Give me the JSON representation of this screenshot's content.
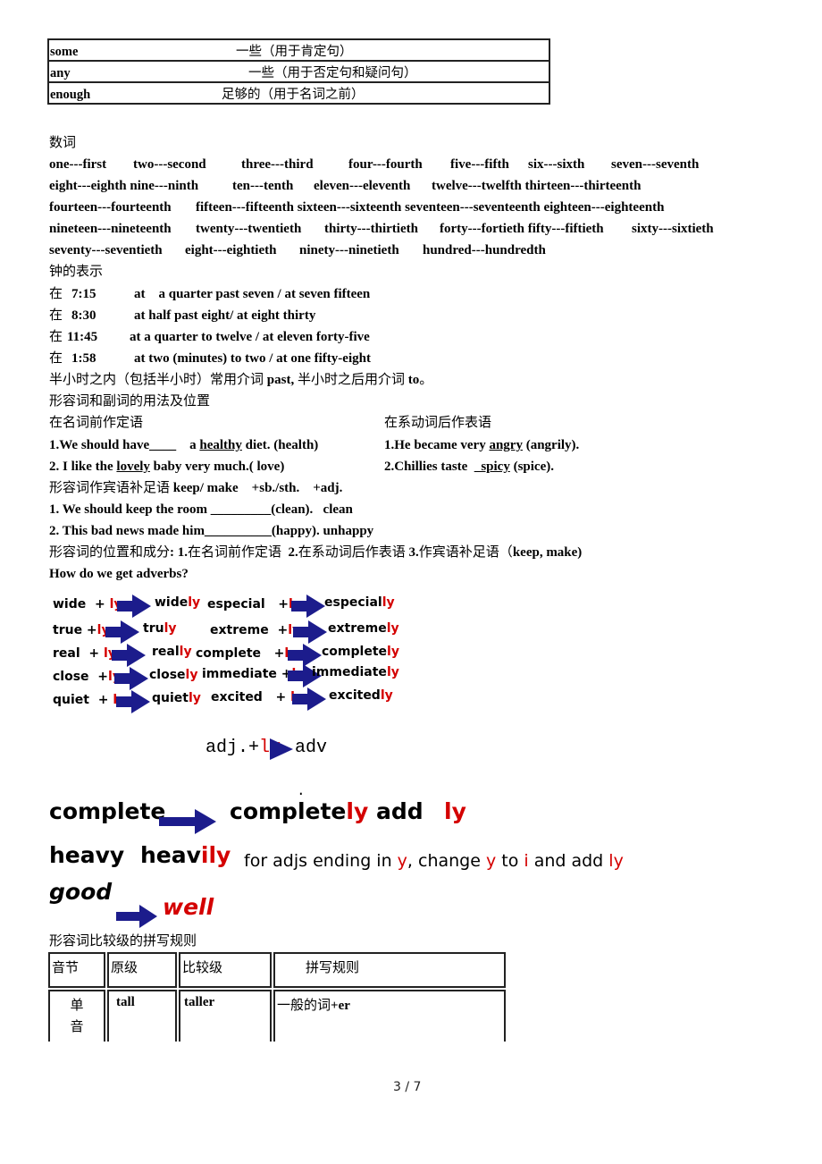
{
  "quantifier_table": [
    {
      "word": "some",
      "meaning": "一些（用于肯定句）"
    },
    {
      "word": "any",
      "meaning": "一些（用于否定句和疑问句）"
    },
    {
      "word": "enough",
      "meaning": "足够的（用于名词之前）"
    }
  ],
  "numerals": {
    "heading": "数词",
    "rows": [
      [
        "one---first",
        "two---second",
        "three---third",
        "four---fourth",
        "five---fifth",
        "six---sixth",
        "seven---seventh"
      ],
      [
        "eight---eighth nine---ninth",
        "ten---tenth",
        "eleven---eleventh",
        "twelve---twelfth thirteen---thirteenth"
      ],
      [
        "fourteen---fourteenth",
        "fifteen---fifteenth sixteen---sixteenth seventeen---seventeenth eighteen---eighteenth"
      ],
      [
        "nineteen---nineteenth",
        "twenty---twentieth",
        "thirty---thirtieth",
        "forty---fortieth fifty---fiftieth",
        "sixty---sixtieth"
      ],
      [
        "seventy---seventieth",
        "eight---eightieth",
        "ninety---ninetieth",
        "hundred---hundredth"
      ]
    ]
  },
  "time": {
    "heading": "钟的表示",
    "prefix": "在",
    "rows": [
      {
        "time": "7:15",
        "expr": "at    a quarter past seven / at seven fifteen"
      },
      {
        "time": "8:30",
        "expr": "at half past eight/ at eight thirty"
      },
      {
        "time": "11:45",
        "expr": "at a quarter to twelve / at eleven forty-five"
      },
      {
        "time": "1:58",
        "expr": "at two (minutes) to two / at one fifty-eight"
      }
    ],
    "note_cn1": "半小时之内（包括半小时）常用介词",
    "note_past": "past,",
    "note_cn2": " 半小时之后用介词",
    "note_to": "to",
    "note_end": "。"
  },
  "adj_adv": {
    "heading": "形容词和副词的用法及位置",
    "left_heading": "在名词前作定语",
    "right_heading": "在系动词后作表语",
    "left_ex1": {
      "pre": "1.We should have____    a ",
      "ans": "healthy",
      "post": " diet. (health)"
    },
    "left_ex2": {
      "pre": "2. I like the ",
      "ans": "lovely",
      "post": " baby very much.( love)"
    },
    "right_ex1": {
      "pre": "1.He became very ",
      "ans": "angry",
      "post": " (angrily)."
    },
    "right_ex2": {
      "pre": "2.Chillies taste  ",
      "ans": "_spicy",
      "post": " (spice)."
    },
    "complement_cn": "形容词作宾语补足语",
    "complement_en": " keep/ make    +sb./sth.    +adj.",
    "comp_ex1": "1. We should keep the room _________(clean).   clean",
    "comp_ex2": "2. This bad news made him__________(happy). unhappy",
    "summary": [
      {
        "t": "形容词的位置和成分",
        "b": false
      },
      {
        "t": ": 1.",
        "b": true
      },
      {
        "t": "在名词前作定语  ",
        "b": false
      },
      {
        "t": "2.",
        "b": true
      },
      {
        "t": "在系动词后作表语 ",
        "b": false
      },
      {
        "t": "3.",
        "b": true
      },
      {
        "t": "作宾语补足语（",
        "b": false
      },
      {
        "t": "keep, make)",
        "b": true
      }
    ],
    "question": "How do we get adverbs?"
  },
  "adverb_examples": [
    {
      "base": "wide  + ",
      "suffix": "ly",
      "result_stem": "wide",
      "result_suffix": "ly"
    },
    {
      "base": "especial   +",
      "suffix": "ly",
      "result_stem": "especial",
      "result_suffix": "ly"
    },
    {
      "base": "true +",
      "suffix": "ly",
      "result_stem": "tru",
      "result_suffix": "ly"
    },
    {
      "base": "extreme  +",
      "suffix": "ly",
      "result_stem": "extreme",
      "result_suffix": "ly"
    },
    {
      "base": "real  + ",
      "suffix": "ly",
      "result_stem": "real",
      "result_suffix": "ly"
    },
    {
      "base": "complete   +",
      "suffix": "ly",
      "result_stem": "complete",
      "result_suffix": "ly"
    },
    {
      "base": "close  +",
      "suffix": "ly",
      "result_stem": "close",
      "result_suffix": "ly"
    },
    {
      "base": "immediate +",
      "suffix": "ly",
      "result_stem": "immediate",
      "result_suffix": "ly"
    },
    {
      "base": "quiet  + ",
      "suffix": "ly",
      "result_stem": "quiet",
      "result_suffix": "ly"
    },
    {
      "base": "excited   + ",
      "suffix": "ly",
      "result_stem": "excited",
      "result_suffix": "ly"
    }
  ],
  "formula": {
    "adj": "adj.+",
    "ly": "ly",
    "adv": "adv",
    "dot": "."
  },
  "rules": {
    "r1_base": "complete",
    "r1_stem": "complete",
    "r1_suffix": "ly",
    "r1_add": "add",
    "r1_ly": "ly",
    "r2_base": "heavy",
    "r2_stem": "heav",
    "r2_suffix": "ily",
    "r2_note": [
      {
        "t": "for adjs ending in ",
        "red": false
      },
      {
        "t": "y",
        "red": true
      },
      {
        "t": ", change ",
        "red": false
      },
      {
        "t": "y",
        "red": true
      },
      {
        "t": " to ",
        "red": false
      },
      {
        "t": "i",
        "red": true
      },
      {
        "t": " and add ",
        "red": false
      },
      {
        "t": "ly",
        "red": true
      }
    ],
    "r3_base": "good",
    "r3_result": "well"
  },
  "comparative": {
    "heading": "形容词比较级的拼写规则",
    "headers": [
      "音节",
      "原级",
      "比较级",
      "拼写规则"
    ],
    "row": {
      "syllable": "单\n音",
      "base": "tall",
      "comparative": "taller",
      "rule_cn": "一般的词",
      "rule_en": "+er"
    }
  },
  "page": {
    "current": "3",
    "sep": "/",
    "total": "7"
  },
  "colors": {
    "accent_red": "#d40000",
    "arrow_navy": "#1c1c8c"
  }
}
